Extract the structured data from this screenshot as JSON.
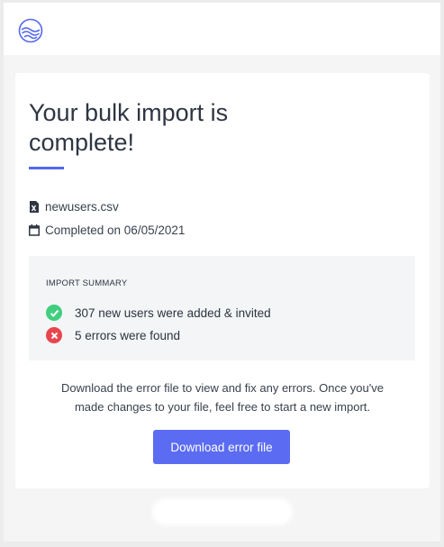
{
  "header": {
    "logo": "waves-logo-icon"
  },
  "card": {
    "title": "Your bulk import is complete!",
    "file": {
      "icon": "excel-file-icon",
      "name": "newusers.csv"
    },
    "completed": {
      "icon": "calendar-icon",
      "text": "Completed on 06/05/2021"
    },
    "summary": {
      "heading": "IMPORT SUMMARY",
      "items": [
        {
          "icon": "check-circle-icon",
          "status": "success",
          "color": "#3fcf7f",
          "text": "307 new users were added & invited"
        },
        {
          "icon": "error-circle-icon",
          "status": "error",
          "color": "#e8464f",
          "text": "5 errors were found"
        }
      ]
    },
    "instructions": "Download the error file to view and fix any errors. Once you've made changes to your file, feel free to start a new import.",
    "download_label": "Download error file"
  },
  "colors": {
    "accent": "#5468f0",
    "button": "#5b6cf2",
    "success": "#3fcf7f",
    "error": "#e8464f"
  }
}
